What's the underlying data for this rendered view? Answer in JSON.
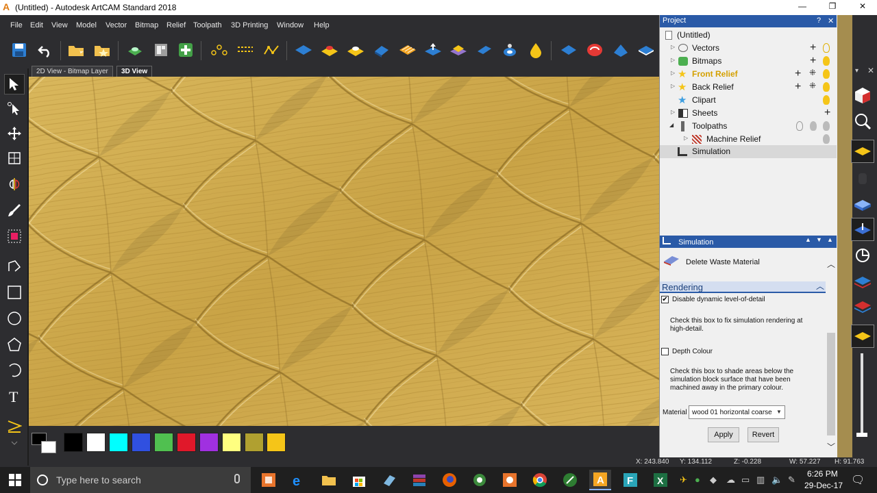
{
  "window": {
    "title": "(Untitled) - Autodesk ArtCAM Standard 2018",
    "logo": "A"
  },
  "menubar": [
    "File",
    "Edit",
    "View",
    "Model",
    "Vector",
    "Bitmap",
    "Relief",
    "Toolpath",
    "3D Printing",
    "Window",
    "Help"
  ],
  "view_tabs": [
    {
      "label": "2D View - Bitmap Layer"
    },
    {
      "label": "3D View"
    }
  ],
  "project": {
    "header": "Project",
    "header_help": "?",
    "header_close": "✕",
    "tree": [
      {
        "label": "(Untitled)"
      },
      {
        "label": "Vectors"
      },
      {
        "label": "Bitmaps"
      },
      {
        "label": "Front Relief"
      },
      {
        "label": "Back Relief"
      },
      {
        "label": "Clipart"
      },
      {
        "label": "Sheets"
      },
      {
        "label": "Toolpaths"
      },
      {
        "label": "Machine Relief"
      },
      {
        "label": "Simulation"
      }
    ]
  },
  "simulation": {
    "header": "Simulation",
    "delete_waste": "Delete Waste Material",
    "rendering_header": "Rendering",
    "disable_lod_label": "Disable dynamic level-of-detail",
    "disable_lod_checked": true,
    "disable_lod_help": "Check this box to fix simulation rendering at high-detail.",
    "depth_colour_label": "Depth Colour",
    "depth_colour_checked": false,
    "depth_colour_help": "Check this box to shade areas below the simulation block surface that have been machined away in the primary colour.",
    "material_label": "Material",
    "material_value": "wood 01 horizontal coarse",
    "apply": "Apply",
    "revert": "Revert"
  },
  "status": {
    "x": "X: 243.840",
    "y": "Y: 134.112",
    "z": "Z: -0.228",
    "w": "W: 57.227",
    "h": "H: 91.763"
  },
  "palette": [
    "#000000",
    "#ffffff",
    "#00ffff",
    "#3050e0",
    "#50c050",
    "#e0182a",
    "#a030e0",
    "#ffff80",
    "#b0a030",
    "#f5c518"
  ],
  "taskbar": {
    "search_placeholder": "Type here to search",
    "time": "6:26 PM",
    "date": "29-Dec-17"
  }
}
